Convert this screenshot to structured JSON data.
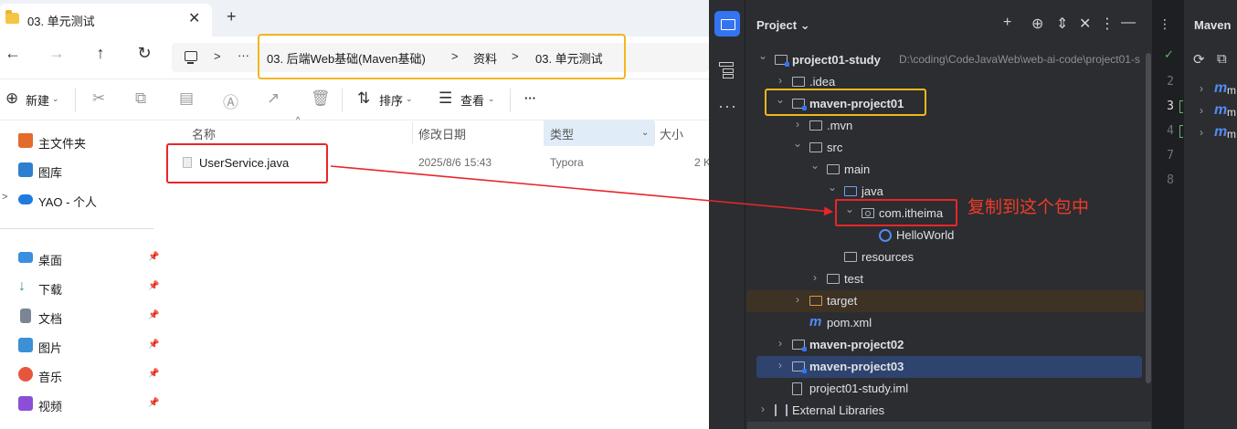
{
  "explorer": {
    "tab_title": "03. 单元测试",
    "tab_close": "✕",
    "new_tab": "+",
    "breadcrumbs": [
      "03. 后端Web基础(Maven基础)",
      "资料",
      "03. 单元测试"
    ],
    "toolbar": {
      "new_label": "新建",
      "sort_label": "排序",
      "view_label": "查看",
      "more": "···"
    },
    "sidebar": {
      "top": [
        {
          "label": "主文件夹",
          "icon": "home-icon",
          "color": "#e36b2c"
        },
        {
          "label": "图库",
          "icon": "gallery-icon",
          "color": "#2f7fd0"
        },
        {
          "label": "YAO - 个人",
          "icon": "onedrive-icon",
          "color": "#1f7be0"
        }
      ],
      "pinned": [
        {
          "label": "桌面",
          "icon": "desktop-icon",
          "color": "#3a8fe0"
        },
        {
          "label": "下载",
          "icon": "download-icon",
          "color": "#2aa35a"
        },
        {
          "label": "文档",
          "icon": "documents-icon",
          "color": "#7c8595"
        },
        {
          "label": "图片",
          "icon": "pictures-icon",
          "color": "#3d8fd6"
        },
        {
          "label": "音乐",
          "icon": "music-icon",
          "color": "#e5563d"
        },
        {
          "label": "视频",
          "icon": "videos-icon",
          "color": "#8a4fd6"
        }
      ]
    },
    "columns": {
      "name": "名称",
      "date": "修改日期",
      "type": "类型",
      "size": "大小"
    },
    "file": {
      "name": "UserService.java",
      "date": "2025/8/6 15:43",
      "type": "Typora",
      "size": "2 K"
    }
  },
  "ide": {
    "panel_title": "Project",
    "tree": [
      {
        "label": "project01-study",
        "path": "D:\\coding\\CodeJavaWeb\\web-ai-code\\project01-s",
        "bold": true,
        "depth": 0,
        "arrow": "open",
        "icon": "module-folder"
      },
      {
        "label": ".idea",
        "depth": 1,
        "arrow": "closed",
        "icon": "folder"
      },
      {
        "label": "maven-project01",
        "bold": true,
        "depth": 1,
        "arrow": "open",
        "icon": "module-folder"
      },
      {
        "label": ".mvn",
        "depth": 2,
        "arrow": "closed",
        "icon": "folder"
      },
      {
        "label": "src",
        "depth": 2,
        "arrow": "open",
        "icon": "folder"
      },
      {
        "label": "main",
        "depth": 3,
        "arrow": "open",
        "icon": "folder"
      },
      {
        "label": "java",
        "depth": 4,
        "arrow": "open",
        "icon": "source-folder"
      },
      {
        "label": "com.itheima",
        "depth": 5,
        "arrow": "open",
        "icon": "package"
      },
      {
        "label": "HelloWorld",
        "depth": 6,
        "arrow": "none",
        "icon": "class"
      },
      {
        "label": "resources",
        "depth": 4,
        "arrow": "none",
        "icon": "folder"
      },
      {
        "label": "test",
        "depth": 3,
        "arrow": "closed",
        "icon": "folder"
      },
      {
        "label": "target",
        "depth": 2,
        "arrow": "closed",
        "icon": "target-folder"
      },
      {
        "label": "pom.xml",
        "depth": 2,
        "arrow": "none",
        "icon": "maven"
      },
      {
        "label": "maven-project02",
        "bold": true,
        "depth": 1,
        "arrow": "closed",
        "icon": "module-folder"
      },
      {
        "label": "maven-project03",
        "bold": true,
        "depth": 1,
        "arrow": "closed",
        "icon": "module-folder"
      },
      {
        "label": "project01-study.iml",
        "depth": 1,
        "arrow": "none",
        "icon": "iml"
      },
      {
        "label": "External Libraries",
        "depth": 0,
        "arrow": "closed",
        "icon": "library"
      }
    ],
    "annotation": "复制到这个包中",
    "line_numbers": [
      "2",
      "3",
      "4",
      "7",
      "8"
    ],
    "current_line": "3",
    "maven_title": "Maven",
    "maven_rows": [
      "m",
      "m",
      "m"
    ],
    "colors": {
      "bg": "#2b2d30",
      "accent": "#3574f0",
      "highlight_yellow": "#f2b71c",
      "highlight_red": "#e8262a"
    }
  }
}
